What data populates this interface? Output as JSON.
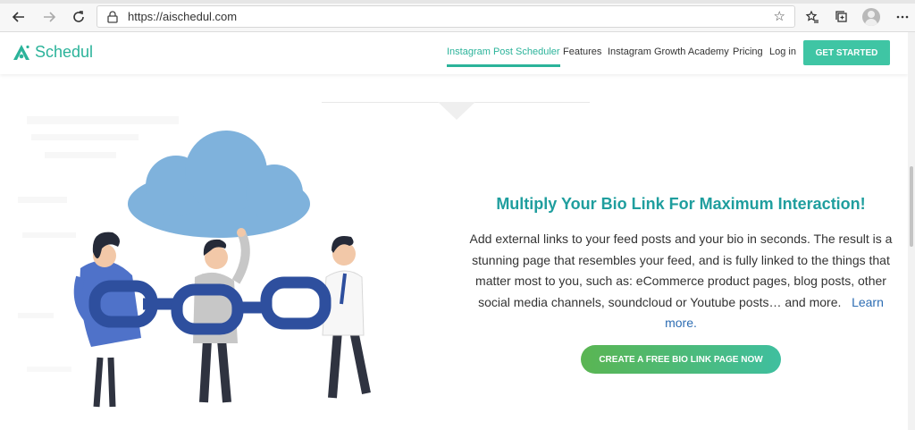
{
  "browser": {
    "url": "https://aischedul.com",
    "icons": {
      "back": "back-arrow-icon",
      "forward": "forward-arrow-icon",
      "refresh": "refresh-icon",
      "lock": "lock-icon",
      "star": "star-icon",
      "favorites": "favorites-icon",
      "collections": "collections-icon",
      "profile": "profile-avatar",
      "more": "more-icon"
    }
  },
  "header": {
    "logo_text": "Schedul",
    "menu": [
      {
        "label": "Instagram Post Scheduler",
        "active": true
      },
      {
        "label": "Features"
      },
      {
        "label": "Instagram Growth Academy"
      },
      {
        "label": "Pricing"
      },
      {
        "label": "Log in"
      }
    ],
    "cta_label": "GET STARTED"
  },
  "content": {
    "title": "Multiply Your Bio Link For Maximum Interaction!",
    "description": "Add external links to your feed posts and your bio in seconds. The result is a stunning page that resembles your feed, and is fully linked to the things that matter most to you, such as: eCommerce product pages, blog posts, other social media channels, soundcloud or Youtube posts… and more.",
    "learn_more": "Learn more.",
    "cta_label": "CREATE A FREE BIO LINK PAGE NOW"
  },
  "colors": {
    "brand": "#2bb39a",
    "title": "#1f9e9e",
    "cloud": "#7fb2dc",
    "chain": "#2e4f9e",
    "link": "#2d6db3"
  }
}
